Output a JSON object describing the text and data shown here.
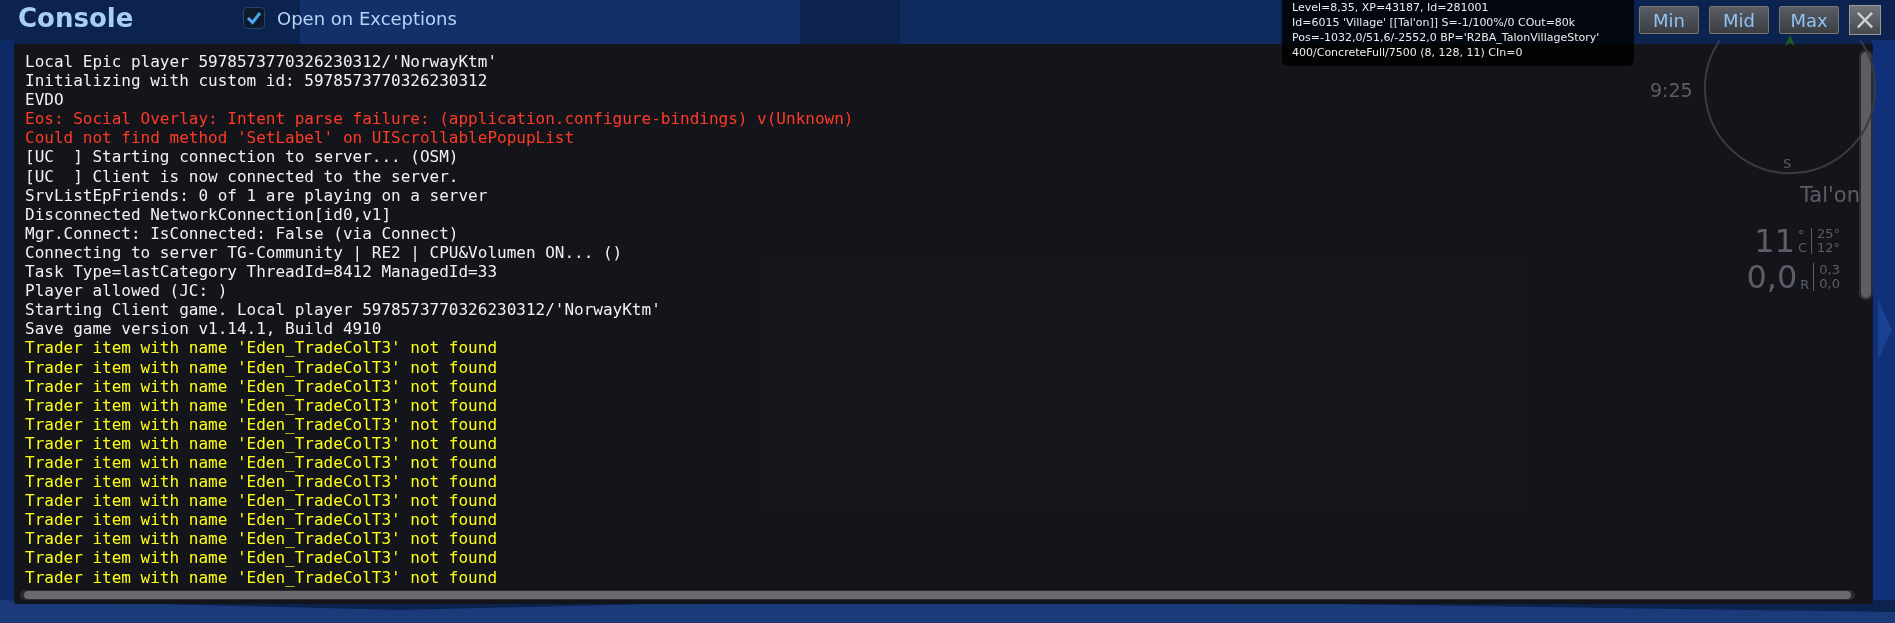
{
  "window": {
    "title": "Console",
    "open_on_exceptions": {
      "label": "Open on Exceptions",
      "checked": true
    },
    "buttons": [
      {
        "label": "Min",
        "kind": "size"
      },
      {
        "label": "Mid",
        "kind": "size"
      },
      {
        "label": "Max",
        "kind": "size"
      },
      {
        "label": "×",
        "kind": "close"
      }
    ]
  },
  "debug_info": [
    "Level=8,35, XP=43187, Id=281001",
    "Id=6015 'Village' [[Tal'on]] S=-1/100%/0 COut=80k",
    "Pos=-1032,0/51,6/-2552,0 BP='R2BA_TalonVillageStory'",
    "400/ConcreteFull/7500 (8, 128, 11) CIn=0"
  ],
  "hud": {
    "time": "9:25",
    "compass_label": "S",
    "location": "Tal'on",
    "temperature": "11",
    "temp_degree": "°",
    "temp_unit": "C",
    "temp_high": "25°",
    "temp_low": "12°",
    "rain": "0,0",
    "rain_unit": "R",
    "rain_high": "0,3",
    "rain_low": "0,0"
  },
  "log": [
    {
      "kind": "info",
      "text": "Local Epic player 5978573770326230312/'NorwayKtm'"
    },
    {
      "kind": "info",
      "text": "Initializing with custom id: 5978573770326230312"
    },
    {
      "kind": "info",
      "text": "EVDO"
    },
    {
      "kind": "error",
      "text": "Eos: Social Overlay: Intent parse failure: (application.configure-bindings) v(Unknown)"
    },
    {
      "kind": "error",
      "text": "Could not find method 'SetLabel' on UIScrollablePopupList"
    },
    {
      "kind": "info",
      "text": "[UC  ] Starting connection to server... (OSM)"
    },
    {
      "kind": "info",
      "text": "[UC  ] Client is now connected to the server."
    },
    {
      "kind": "info",
      "text": "SrvListEpFriends: 0 of 1 are playing on a server"
    },
    {
      "kind": "info",
      "text": "Disconnected NetworkConnection[id0,v1]"
    },
    {
      "kind": "info",
      "text": "Mgr.Connect: IsConnected: False (via Connect)"
    },
    {
      "kind": "info",
      "text": "Connecting to server TG-Community | RE2 | CPU&Volumen ON... ()"
    },
    {
      "kind": "info",
      "text": "Task Type=lastCategory ThreadId=8412 ManagedId=33"
    },
    {
      "kind": "info",
      "text": "Player allowed (JC: )"
    },
    {
      "kind": "info",
      "text": "Starting Client game. Local player 5978573770326230312/'NorwayKtm'"
    },
    {
      "kind": "info",
      "text": "Save game version v1.14.1, Build 4910"
    },
    {
      "kind": "warning",
      "text": "Trader item with name 'Eden_TradeColT3' not found"
    },
    {
      "kind": "warning",
      "text": "Trader item with name 'Eden_TradeColT3' not found"
    },
    {
      "kind": "warning",
      "text": "Trader item with name 'Eden_TradeColT3' not found"
    },
    {
      "kind": "warning",
      "text": "Trader item with name 'Eden_TradeColT3' not found"
    },
    {
      "kind": "warning",
      "text": "Trader item with name 'Eden_TradeColT3' not found"
    },
    {
      "kind": "warning",
      "text": "Trader item with name 'Eden_TradeColT3' not found"
    },
    {
      "kind": "warning",
      "text": "Trader item with name 'Eden_TradeColT3' not found"
    },
    {
      "kind": "warning",
      "text": "Trader item with name 'Eden_TradeColT3' not found"
    },
    {
      "kind": "warning",
      "text": "Trader item with name 'Eden_TradeColT3' not found"
    },
    {
      "kind": "warning",
      "text": "Trader item with name 'Eden_TradeColT3' not found"
    },
    {
      "kind": "warning",
      "text": "Trader item with name 'Eden_TradeColT3' not found"
    },
    {
      "kind": "warning",
      "text": "Trader item with name 'Eden_TradeColT3' not found"
    },
    {
      "kind": "warning",
      "text": "Trader item with name 'Eden_TradeColT3' not found"
    }
  ]
}
